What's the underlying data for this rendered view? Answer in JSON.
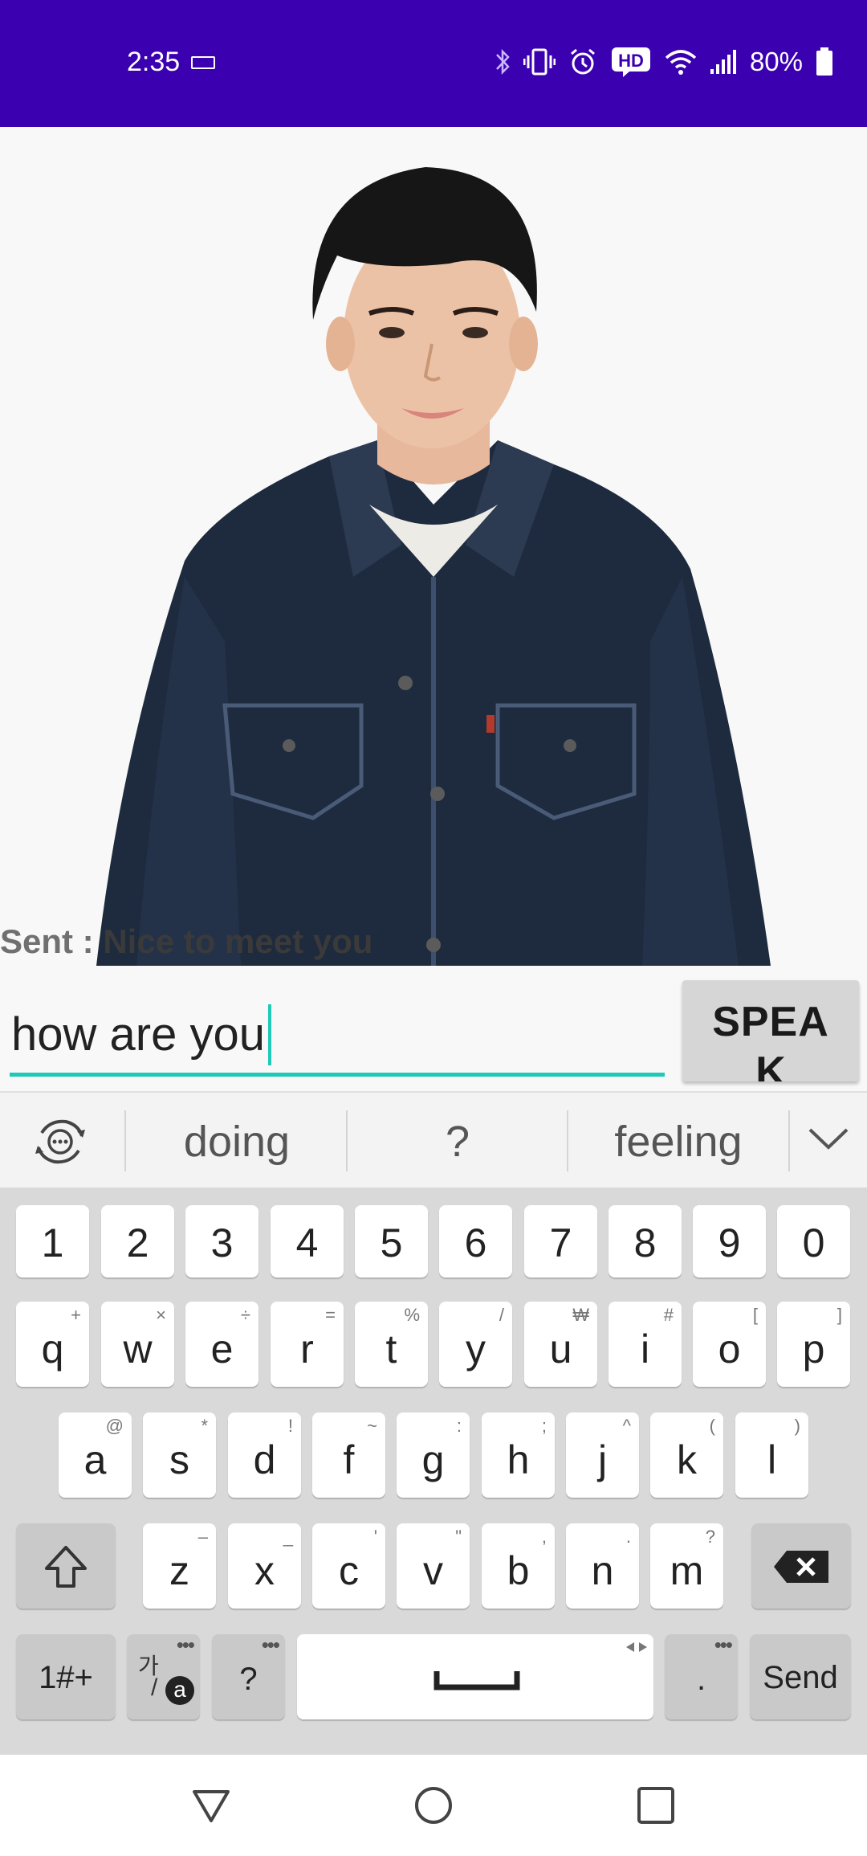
{
  "status_bar": {
    "time": "2:35",
    "battery_text": "80%",
    "icons": [
      "keyboard-icon",
      "bluetooth-icon",
      "vibrate-icon",
      "alarm-icon",
      "hd-icon",
      "wifi-icon",
      "signal-icon",
      "battery-icon"
    ]
  },
  "avatar": {
    "sent_label": "Sent : ",
    "sent_message": "Nice to meet you"
  },
  "input": {
    "value": "how are you"
  },
  "speak_button": {
    "label": "SPEA",
    "label_overflow": "K"
  },
  "keyboard": {
    "suggestions": [
      "doing",
      "?",
      "feeling"
    ],
    "number_row": [
      "1",
      "2",
      "3",
      "4",
      "5",
      "6",
      "7",
      "8",
      "9",
      "0"
    ],
    "row1": [
      {
        "key": "q",
        "sec": "+"
      },
      {
        "key": "w",
        "sec": "×"
      },
      {
        "key": "e",
        "sec": "÷"
      },
      {
        "key": "r",
        "sec": "="
      },
      {
        "key": "t",
        "sec": "%"
      },
      {
        "key": "y",
        "sec": "/"
      },
      {
        "key": "u",
        "sec": "₩"
      },
      {
        "key": "i",
        "sec": "#"
      },
      {
        "key": "o",
        "sec": "["
      },
      {
        "key": "p",
        "sec": "]"
      }
    ],
    "row2": [
      {
        "key": "a",
        "sec": "@"
      },
      {
        "key": "s",
        "sec": "*"
      },
      {
        "key": "d",
        "sec": "!"
      },
      {
        "key": "f",
        "sec": "~"
      },
      {
        "key": "g",
        "sec": ":"
      },
      {
        "key": "h",
        "sec": ";"
      },
      {
        "key": "j",
        "sec": "^"
      },
      {
        "key": "k",
        "sec": "("
      },
      {
        "key": "l",
        "sec": ")"
      }
    ],
    "row3": [
      {
        "key": "z",
        "sec": "–"
      },
      {
        "key": "x",
        "sec": "_"
      },
      {
        "key": "c",
        "sec": "'"
      },
      {
        "key": "v",
        "sec": "\""
      },
      {
        "key": "b",
        "sec": ","
      },
      {
        "key": "n",
        "sec": "."
      },
      {
        "key": "m",
        "sec": "?"
      }
    ],
    "symbols_key": "1#+",
    "lang_key": "가",
    "lang_key_sub": "a",
    "question_key": "?",
    "period_key": ".",
    "send_key": "Send"
  },
  "colors": {
    "status_bar_bg": "#3b00b0",
    "input_underline": "#1fc8b8",
    "speak_button_bg": "#d6d6d6"
  }
}
